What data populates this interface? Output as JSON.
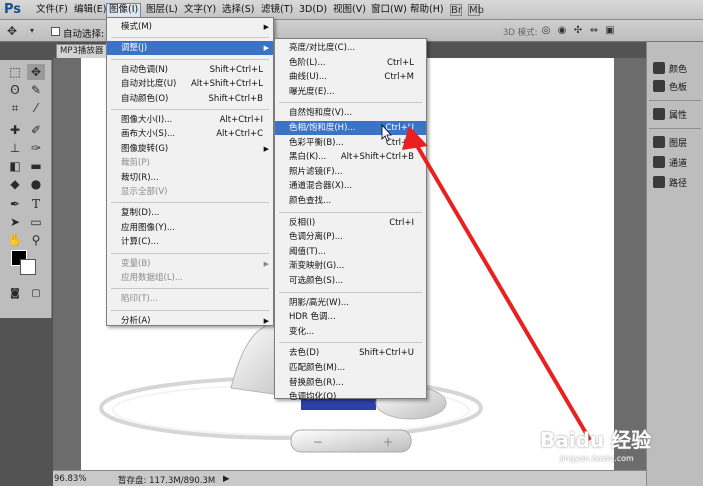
{
  "app": {
    "logo": "Ps"
  },
  "menubar": {
    "items": [
      "文件(F)",
      "编辑(E)",
      "图像(I)",
      "图层(L)",
      "文字(Y)",
      "选择(S)",
      "滤镜(T)",
      "3D(D)",
      "视图(V)",
      "窗口(W)",
      "帮助(H)"
    ],
    "active_index": 2
  },
  "options_bar": {
    "auto_select_label": "自动选择:",
    "mode3d_label": "3D 模式:"
  },
  "document": {
    "tab_title": "MP3播放器"
  },
  "status_bar": {
    "zoom": "96.83%",
    "scratch": "暂存盘: 117.3M/890.3M"
  },
  "dock": {
    "group1": [
      "颜色",
      "色板"
    ],
    "group2": [
      "属性"
    ],
    "group3": [
      "图层",
      "通道",
      "路径"
    ]
  },
  "image_menu": {
    "items": [
      {
        "label": "模式(M)",
        "shortcut": "",
        "submenu": true,
        "disabled": false,
        "highlight": false
      },
      {
        "sep": true
      },
      {
        "label": "调整(J)",
        "shortcut": "",
        "submenu": true,
        "disabled": false,
        "highlight": true
      },
      {
        "sep": true
      },
      {
        "label": "自动色调(N)",
        "shortcut": "Shift+Ctrl+L",
        "submenu": false,
        "disabled": false,
        "highlight": false
      },
      {
        "label": "自动对比度(U)",
        "shortcut": "Alt+Shift+Ctrl+L",
        "submenu": false,
        "disabled": false,
        "highlight": false
      },
      {
        "label": "自动颜色(O)",
        "shortcut": "Shift+Ctrl+B",
        "submenu": false,
        "disabled": false,
        "highlight": false
      },
      {
        "sep": true
      },
      {
        "label": "图像大小(I)...",
        "shortcut": "Alt+Ctrl+I",
        "submenu": false,
        "disabled": false,
        "highlight": false
      },
      {
        "label": "画布大小(S)...",
        "shortcut": "Alt+Ctrl+C",
        "submenu": false,
        "disabled": false,
        "highlight": false
      },
      {
        "label": "图像旋转(G)",
        "shortcut": "",
        "submenu": true,
        "disabled": false,
        "highlight": false
      },
      {
        "label": "裁剪(P)",
        "shortcut": "",
        "submenu": false,
        "disabled": true,
        "highlight": false
      },
      {
        "label": "裁切(R)...",
        "shortcut": "",
        "submenu": false,
        "disabled": false,
        "highlight": false
      },
      {
        "label": "显示全部(V)",
        "shortcut": "",
        "submenu": false,
        "disabled": true,
        "highlight": false
      },
      {
        "sep": true
      },
      {
        "label": "复制(D)...",
        "shortcut": "",
        "submenu": false,
        "disabled": false,
        "highlight": false
      },
      {
        "label": "应用图像(Y)...",
        "shortcut": "",
        "submenu": false,
        "disabled": false,
        "highlight": false
      },
      {
        "label": "计算(C)...",
        "shortcut": "",
        "submenu": false,
        "disabled": false,
        "highlight": false
      },
      {
        "sep": true
      },
      {
        "label": "变量(B)",
        "shortcut": "",
        "submenu": true,
        "disabled": true,
        "highlight": false
      },
      {
        "label": "应用数据组(L)...",
        "shortcut": "",
        "submenu": false,
        "disabled": true,
        "highlight": false
      },
      {
        "sep": true
      },
      {
        "label": "陷印(T)...",
        "shortcut": "",
        "submenu": false,
        "disabled": true,
        "highlight": false
      },
      {
        "sep": true
      },
      {
        "label": "分析(A)",
        "shortcut": "",
        "submenu": true,
        "disabled": false,
        "highlight": false
      }
    ]
  },
  "adjust_menu": {
    "items": [
      {
        "label": "亮度/对比度(C)...",
        "shortcut": "",
        "highlight": false
      },
      {
        "label": "色阶(L)...",
        "shortcut": "Ctrl+L",
        "highlight": false
      },
      {
        "label": "曲线(U)...",
        "shortcut": "Ctrl+M",
        "highlight": false
      },
      {
        "label": "曝光度(E)...",
        "shortcut": "",
        "highlight": false
      },
      {
        "sep": true
      },
      {
        "label": "自然饱和度(V)...",
        "shortcut": "",
        "highlight": false
      },
      {
        "label": "色相/饱和度(H)...",
        "shortcut": "Ctrl+U",
        "highlight": true
      },
      {
        "label": "色彩平衡(B)...",
        "shortcut": "Ctrl+B",
        "highlight": false
      },
      {
        "label": "黑白(K)...",
        "shortcut": "Alt+Shift+Ctrl+B",
        "highlight": false
      },
      {
        "label": "照片滤镜(F)...",
        "shortcut": "",
        "highlight": false
      },
      {
        "label": "通道混合器(X)...",
        "shortcut": "",
        "highlight": false
      },
      {
        "label": "颜色查找...",
        "shortcut": "",
        "highlight": false
      },
      {
        "sep": true
      },
      {
        "label": "反相(I)",
        "shortcut": "Ctrl+I",
        "highlight": false
      },
      {
        "label": "色调分离(P)...",
        "shortcut": "",
        "highlight": false
      },
      {
        "label": "阈值(T)...",
        "shortcut": "",
        "highlight": false
      },
      {
        "label": "渐变映射(G)...",
        "shortcut": "",
        "highlight": false
      },
      {
        "label": "可选颜色(S)...",
        "shortcut": "",
        "highlight": false
      },
      {
        "sep": true
      },
      {
        "label": "阴影/高光(W)...",
        "shortcut": "",
        "highlight": false
      },
      {
        "label": "HDR 色调...",
        "shortcut": "",
        "highlight": false
      },
      {
        "label": "变化...",
        "shortcut": "",
        "highlight": false
      },
      {
        "sep": true
      },
      {
        "label": "去色(D)",
        "shortcut": "Shift+Ctrl+U",
        "highlight": false
      },
      {
        "label": "匹配颜色(M)...",
        "shortcut": "",
        "highlight": false
      },
      {
        "label": "替换颜色(R)...",
        "shortcut": "",
        "highlight": false
      },
      {
        "label": "色调均化(Q)",
        "shortcut": "",
        "highlight": false
      }
    ]
  },
  "watermark": {
    "text": "Baidu 经验",
    "sub": "jingyan.baidu.com"
  },
  "colors": {
    "highlight": "#3b73c7",
    "arrow": "#e8201f"
  }
}
